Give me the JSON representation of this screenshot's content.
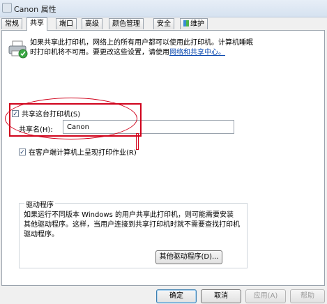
{
  "window": {
    "title": "Canon 属性"
  },
  "tabs": [
    {
      "label": "常规"
    },
    {
      "label": "共享"
    },
    {
      "label": "端口"
    },
    {
      "label": "高级"
    },
    {
      "label": "颜色管理"
    },
    {
      "label": "安全"
    },
    {
      "label": "维护"
    }
  ],
  "share": {
    "intro_text": "如果共享此打印机，网络上的所有用户都可以使用此打印机。计算机睡眠时打印机将不可用。要更改这些设置，请使用",
    "intro_link": "网络和共享中心。",
    "share_checkbox_label": "共享这台打印机(S)",
    "share_checked": true,
    "share_name_label": "共享名(H):",
    "share_name_value": "Canon",
    "render_jobs_label": "在客户端计算机上呈现打印作业(R)",
    "render_jobs_checked": true
  },
  "drivers": {
    "group_title": "驱动程序",
    "description": "如果运行不同版本 Windows 的用户共享此打印机，则可能需要安装其他驱动程序。这样，当用户连接到共享打印机时就不需要查找打印机驱动程序。",
    "other_drivers_button": "其他驱动程序(D)..."
  },
  "buttons": {
    "ok": "确定",
    "cancel": "取消",
    "apply": "应用(A)",
    "help": "帮助"
  },
  "colors": {
    "annotation": "#d0021b",
    "link": "#0645ad",
    "default_button_border": "#3c7fb1"
  }
}
